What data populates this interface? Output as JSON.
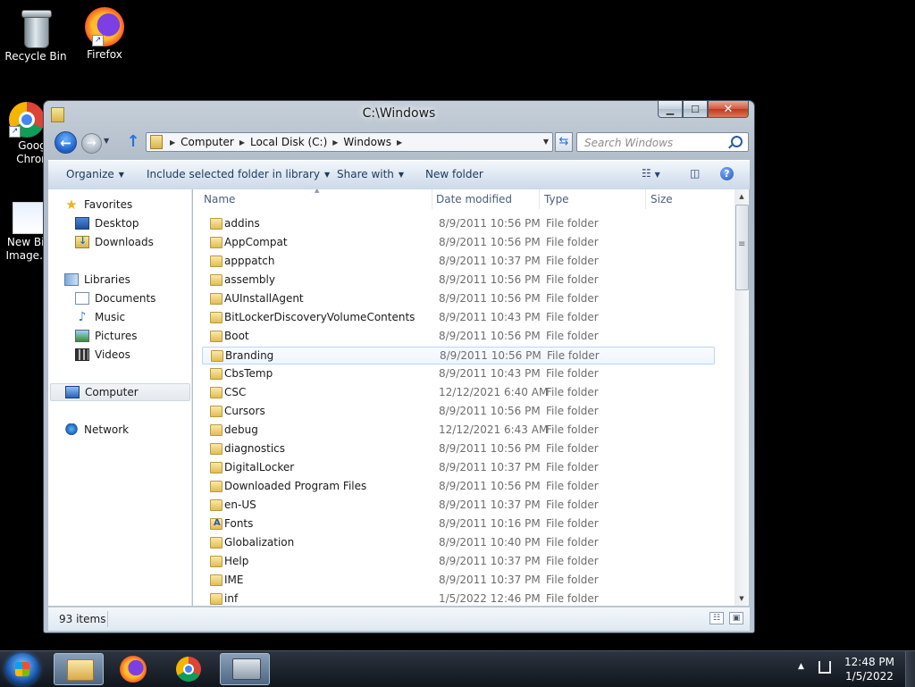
{
  "desktop": {
    "icons": [
      {
        "label": "Recycle Bin"
      },
      {
        "label": "Firefox"
      },
      {
        "label": "Goog Chron"
      },
      {
        "label": "New Bit Image.b"
      }
    ]
  },
  "window": {
    "title": "C:\\Windows",
    "address": [
      "Computer",
      "Local Disk (C:)",
      "Windows"
    ],
    "search_placeholder": "Search Windows",
    "toolbar": {
      "organize": "Organize",
      "include": "Include selected folder in library",
      "share": "Share with",
      "new_folder": "New folder"
    },
    "nav": {
      "favorites": "Favorites",
      "desktop": "Desktop",
      "downloads": "Downloads",
      "libraries": "Libraries",
      "documents": "Documents",
      "music": "Music",
      "pictures": "Pictures",
      "videos": "Videos",
      "computer": "Computer",
      "network": "Network"
    },
    "columns": {
      "name": "Name",
      "date": "Date modified",
      "type": "Type",
      "size": "Size"
    },
    "files": [
      {
        "name": "addins",
        "date": "8/9/2011 10:56 PM",
        "type": "File folder"
      },
      {
        "name": "AppCompat",
        "date": "8/9/2011 10:56 PM",
        "type": "File folder"
      },
      {
        "name": "apppatch",
        "date": "8/9/2011 10:37 PM",
        "type": "File folder"
      },
      {
        "name": "assembly",
        "date": "8/9/2011 10:56 PM",
        "type": "File folder"
      },
      {
        "name": "AUInstallAgent",
        "date": "8/9/2011 10:56 PM",
        "type": "File folder"
      },
      {
        "name": "BitLockerDiscoveryVolumeContents",
        "date": "8/9/2011 10:43 PM",
        "type": "File folder"
      },
      {
        "name": "Boot",
        "date": "8/9/2011 10:56 PM",
        "type": "File folder"
      },
      {
        "name": "Branding",
        "date": "8/9/2011 10:56 PM",
        "type": "File folder"
      },
      {
        "name": "CbsTemp",
        "date": "8/9/2011 10:43 PM",
        "type": "File folder"
      },
      {
        "name": "CSC",
        "date": "12/12/2021 6:40 AM",
        "type": "File folder"
      },
      {
        "name": "Cursors",
        "date": "8/9/2011 10:56 PM",
        "type": "File folder"
      },
      {
        "name": "debug",
        "date": "12/12/2021 6:43 AM",
        "type": "File folder"
      },
      {
        "name": "diagnostics",
        "date": "8/9/2011 10:56 PM",
        "type": "File folder"
      },
      {
        "name": "DigitalLocker",
        "date": "8/9/2011 10:37 PM",
        "type": "File folder"
      },
      {
        "name": "Downloaded Program Files",
        "date": "8/9/2011 10:56 PM",
        "type": "File folder"
      },
      {
        "name": "en-US",
        "date": "8/9/2011 10:37 PM",
        "type": "File folder"
      },
      {
        "name": "Fonts",
        "date": "8/9/2011 10:16 PM",
        "type": "File folder"
      },
      {
        "name": "Globalization",
        "date": "8/9/2011 10:40 PM",
        "type": "File folder"
      },
      {
        "name": "Help",
        "date": "8/9/2011 10:37 PM",
        "type": "File folder"
      },
      {
        "name": "IME",
        "date": "8/9/2011 10:37 PM",
        "type": "File folder"
      },
      {
        "name": "inf",
        "date": "1/5/2022 12:46 PM",
        "type": "File folder"
      }
    ],
    "status": "93 items"
  },
  "taskbar": {
    "time": "12:48 PM",
    "date": "1/5/2022"
  }
}
